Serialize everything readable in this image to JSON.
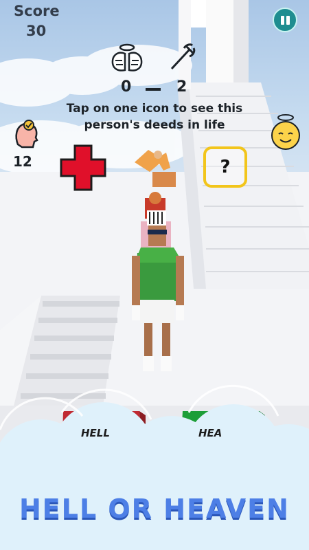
{
  "hud": {
    "score_label": "Score",
    "score_value": "30",
    "age_value": "12"
  },
  "votes": {
    "heaven_count": "0",
    "hell_count": "2"
  },
  "instruction": {
    "line1": "Tap on one icon to see this",
    "line2": "person's deeds in life"
  },
  "question_mark": "?",
  "doors": {
    "hell_label": "HELL",
    "heaven_label": "HEA"
  },
  "banner_title": "HELL OR HEAVEN",
  "colors": {
    "pause": "#1e8d90",
    "cross": "#e0102a",
    "question_border": "#f2c51b",
    "hell_door": "#d2303a",
    "heaven_door": "#1fa13a",
    "banner_text": "#4d7fe6"
  },
  "icons": {
    "pause": "pause-icon",
    "angel_wings": "angel-wings-icon",
    "devil_trident": "devil-trident-icon",
    "head_halo": "head-halo-icon",
    "angel_face": "angel-emoji-icon",
    "red_cross": "red-cross-icon"
  }
}
